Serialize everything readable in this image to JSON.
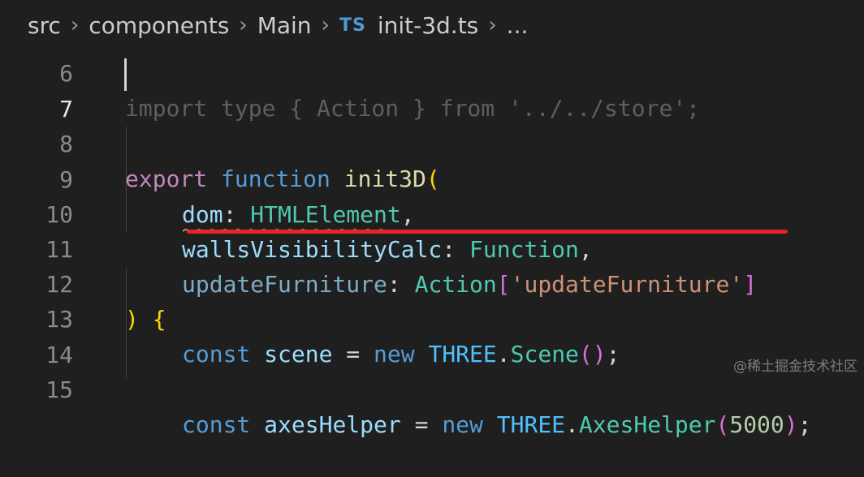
{
  "breadcrumb": {
    "items": [
      "src",
      "components",
      "Main"
    ],
    "file_icon": "TS",
    "file_name": "init-3d.ts",
    "more": "..."
  },
  "lines": {
    "l6": {
      "number": "6",
      "text": "import type { Action } from '../../store';"
    },
    "l7": {
      "number": "7"
    },
    "l8": {
      "number": "8",
      "t1": "export",
      "t2": "function",
      "t3": "init3D",
      "t4": "("
    },
    "l9": {
      "number": "9",
      "t1": "dom",
      "t2": ": ",
      "t3": "HTMLElement",
      "t4": ","
    },
    "l10": {
      "number": "10",
      "t1": "wallsVisibilityCalc",
      "t2": ": ",
      "t3": "Function",
      "t4": ","
    },
    "l11": {
      "number": "11",
      "t1": "updateFurniture",
      "t2": ": ",
      "t3": "Action",
      "t4": "[",
      "t5": "'updateFurniture'",
      "t6": "]"
    },
    "l12": {
      "number": "12",
      "t1": ")",
      "t2": "{"
    },
    "l13": {
      "number": "13",
      "t1": "const",
      "t2": "scene",
      "t3": " = ",
      "t4": "new",
      "t5": "THREE",
      "t6": ".",
      "t7": "Scene",
      "t8": "()",
      "t9": ";"
    },
    "l14": {
      "number": "14"
    },
    "l15": {
      "number": "15",
      "t1": "const",
      "t2": "axesHelper",
      "t3": " = ",
      "t4": "new",
      "t5": "THREE",
      "t6": ".",
      "t7": "AxesHelper",
      "t8": "(",
      "t9": "5000",
      "t10": ")",
      "t11": ";"
    }
  },
  "watermark": "@稀土掘金技术社区",
  "colors": {
    "background": "#1f1f1f",
    "keyword": "#c586c0",
    "storage": "#569cd6",
    "function": "#dcdcaa",
    "variable": "#9cdcfe",
    "type": "#4ec9b0",
    "string": "#ce9178",
    "number": "#b5cea8",
    "annotation_red": "#e8232a",
    "warning_squiggle": "#e2b93d"
  }
}
